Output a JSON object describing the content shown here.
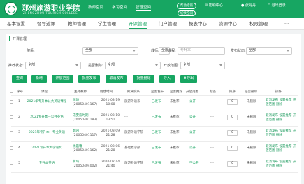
{
  "header": {
    "school_name": "郑州旅游职业学院",
    "school_name_en": "ZHENGZHOU TOURISM COLLEGE",
    "nav": [
      "教师空间",
      "学习空间",
      "管理空间"
    ],
    "active_nav": "管理空间",
    "buttons": [
      "帮助指南",
      "切换空间"
    ],
    "message": "帮助中心",
    "user": "张丹丹",
    "logout": "退出登录"
  },
  "subnav": {
    "items": [
      "基本设置",
      "督导巡课",
      "教师管理",
      "学生管理",
      "开课管理",
      "门户管理",
      "报表中心",
      "资源中心",
      "权限管理",
      "···"
    ],
    "active": "开课管理"
  },
  "breadcrumb": "开课管理",
  "filters": {
    "college_label": "院系:",
    "college_value": "全部",
    "teacher_label": "教师:",
    "teacher_value": "全部",
    "course_label": "课程:",
    "course_placeholder": "专升本",
    "publish_label": "发布状态:",
    "publish_value": "全部",
    "recommend_label": "推荐状态:",
    "recommend_value": "全部",
    "delete_label": "是否删除:",
    "delete_value": "全部",
    "open_label": "开放范围:",
    "open_value": "全部"
  },
  "actions": [
    "查询",
    "新增",
    "开放范围",
    "批量发布",
    "取消发布",
    "批量删除",
    "导入",
    "导出"
  ],
  "table": {
    "columns": [
      "序号",
      "课程",
      "主持教师",
      "创建时间",
      "所属院系",
      "是否发布",
      "是否推荐",
      "开放范围",
      "标签",
      "排序",
      "是否删除",
      "操作"
    ],
    "rows": [
      {
        "no": "1",
        "course": "2021年专升本公共英语课程",
        "teacher": "张琦",
        "teacher_id": "(20050401167)",
        "time": "2021-03-19 10:08",
        "dept": "旅游外语系",
        "published": "已发布",
        "recommend": "未推荐",
        "open": "公开",
        "tag": "---",
        "sort": "0",
        "deleted": "未删除",
        "ops": "取消发布 设置推荐 开放范围 删除"
      },
      {
        "no": "2",
        "course": "2021专升本—公共英语",
        "teacher": "成雯波时期",
        "teacher_id": "(20050401183)",
        "time": "2021-03-10 13:51",
        "dept": "---",
        "published": "已发布",
        "recommend": "未推荐",
        "open": "公开",
        "tag": "---",
        "sort": "0",
        "deleted": "未删除",
        "ops": "取消发布 设置推荐 开放范围 删除"
      },
      {
        "no": "3",
        "course": "2021年专升本—专业英语",
        "teacher": "魏园",
        "teacher_id": "(20050401117)",
        "time": "2021-03-09 21:28",
        "dept": "旅游外语学院",
        "published": "已发布",
        "recommend": "未推荐",
        "open": "公开",
        "tag": "---",
        "sort": "0",
        "deleted": "未删除",
        "ops": "取消发布 设置推荐 开放范围 删除"
      },
      {
        "no": "4",
        "course": "2021专升本大学语文",
        "teacher": "杨晨馨",
        "teacher_id": "(20050401162)",
        "time": "2021-03-06 21:28",
        "dept": "基础教学部",
        "published": "已发布",
        "recommend": "未推荐",
        "open": "公开",
        "tag": "---",
        "sort": "0",
        "deleted": "未删除",
        "ops": "取消发布 设置推荐 开放范围 删除"
      },
      {
        "no": "5",
        "course": "专升本英语",
        "teacher": "蒋琦",
        "teacher_id": "(20050404002)",
        "time": "2020-02-14 21:40",
        "dept": "旅游外语学院",
        "published": "已发布",
        "recommend": "未推荐",
        "open": "不公开",
        "tag": "---",
        "sort": "0",
        "deleted": "未删除",
        "ops": "取消发布 设置推荐 开放范围 删除"
      }
    ]
  },
  "colors": {
    "brand": "#17a662"
  }
}
